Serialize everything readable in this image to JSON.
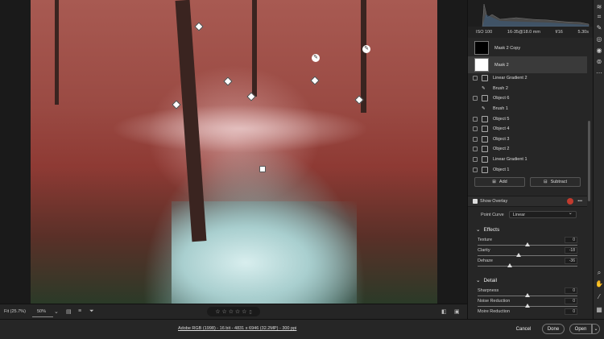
{
  "camera": {
    "iso": "ISO 100",
    "lens": "16-35@18.0 mm",
    "aperture": "f/16",
    "shutter": "5.30s"
  },
  "masks": {
    "big": [
      {
        "label": "Mask 2 Copy"
      },
      {
        "label": "Mask 2"
      }
    ],
    "components": [
      "Linear Gradient 2",
      "Brush 2",
      "Object 6",
      "Brush 1",
      "Object 5",
      "Object 4",
      "Object 3",
      "Object 2",
      "Linear Gradient 1",
      "Object 1"
    ],
    "add_label": "Add",
    "subtract_label": "Subtract"
  },
  "overlay": {
    "label": "Show Overlay",
    "color": "#c23b2e"
  },
  "point_curve": {
    "label": "Point Curve",
    "value": "Linear"
  },
  "effects": {
    "title": "Effects",
    "sliders": [
      {
        "label": "Texture",
        "value": "0",
        "level": 0.5
      },
      {
        "label": "Clarity",
        "value": "-18",
        "level": 0.41
      },
      {
        "label": "Dehaze",
        "value": "-36",
        "level": 0.32
      }
    ]
  },
  "detail": {
    "title": "Detail",
    "sliders": [
      {
        "label": "Sharpness",
        "value": "0",
        "level": 0.5
      },
      {
        "label": "Noise Reduction",
        "value": "0",
        "level": 0.5
      },
      {
        "label": "Moire Reduction",
        "value": "0",
        "level": 0.5
      }
    ]
  },
  "bottombar": {
    "fit": "Fit (25.7%)",
    "zoom": "50%",
    "stars": "☆ ☆ ☆ ☆ ☆"
  },
  "footer": {
    "file_info": "Adobe RGB (1998) - 16 bit - 4831 x 6946 (32.2MP) - 300 ppi",
    "cancel": "Cancel",
    "done": "Done",
    "open": "Open"
  }
}
